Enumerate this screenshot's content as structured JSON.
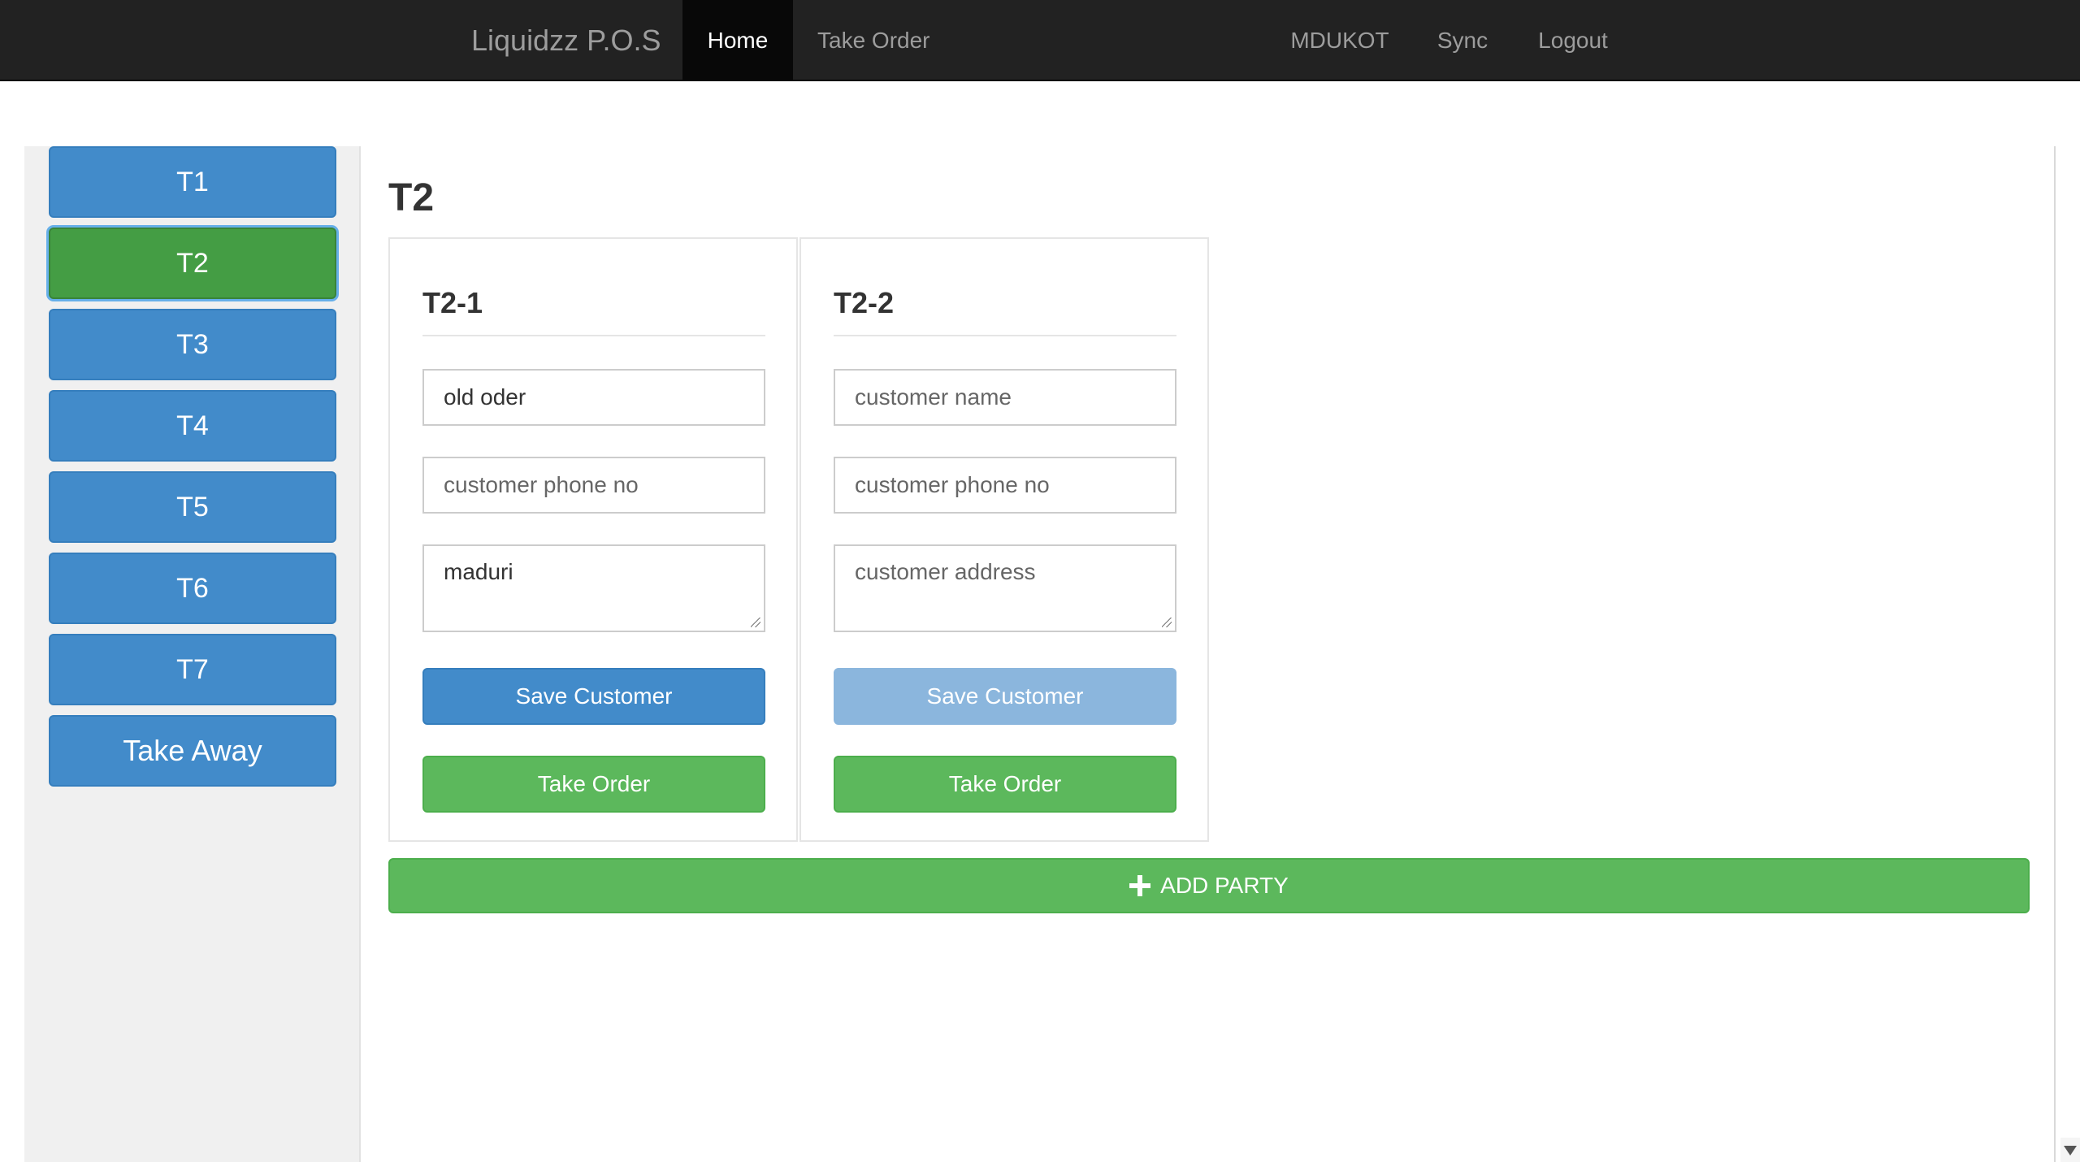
{
  "navbar": {
    "brand": "Liquidzz P.O.S",
    "links": {
      "home": "Home",
      "take_order": "Take Order",
      "mdukot": "MDUKOT",
      "sync": "Sync",
      "logout": "Logout"
    }
  },
  "sidebar": {
    "tables": [
      "T1",
      "T2",
      "T3",
      "T4",
      "T5",
      "T6",
      "T7",
      "Take Away"
    ],
    "active": "T2"
  },
  "main": {
    "title": "T2",
    "parties": [
      {
        "title": "T2-1",
        "name_value": "old oder",
        "phone_placeholder": "customer phone no",
        "address_value": "maduri",
        "save_label": "Save Customer",
        "order_label": "Take Order"
      },
      {
        "title": "T2-2",
        "name_placeholder": "customer name",
        "phone_placeholder": "customer phone no",
        "address_placeholder": "customer address",
        "save_label": "Save Customer",
        "order_label": "Take Order"
      }
    ],
    "add_party_label": "ADD PARTY"
  },
  "colors": {
    "navbar_bg": "#222222",
    "primary": "#428bca",
    "success": "#5cb85c",
    "active_table": "#449d44"
  }
}
